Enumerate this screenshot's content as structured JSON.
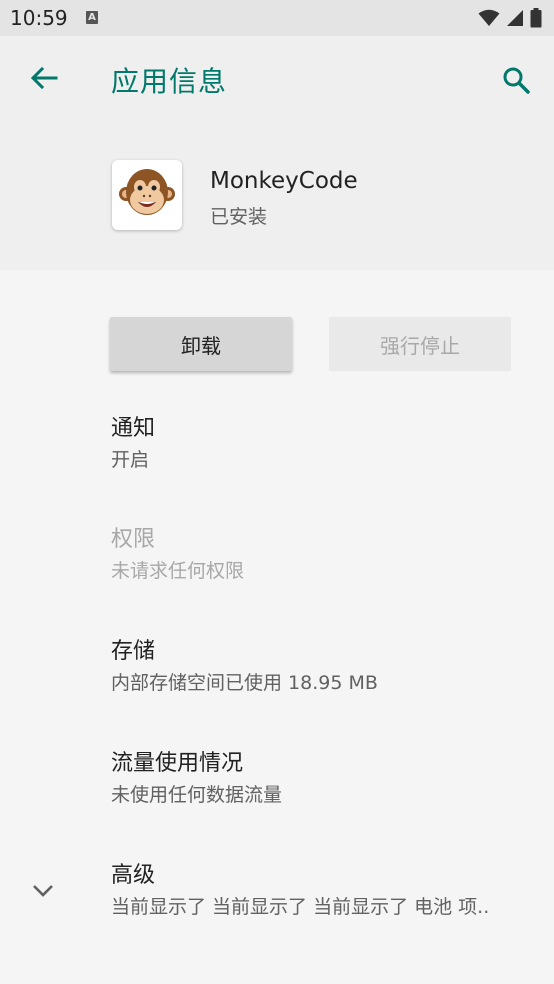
{
  "status_bar": {
    "time": "10:59",
    "notification_icon": "A",
    "icons": [
      "wifi-icon",
      "signal-icon",
      "battery-icon"
    ]
  },
  "header": {
    "title": "应用信息",
    "back_icon": "arrow-left-icon",
    "search_icon": "search-icon"
  },
  "app": {
    "name": "MonkeyCode",
    "status": "已安装",
    "icon": "monkey-face-icon"
  },
  "buttons": {
    "uninstall": "卸载",
    "force_stop": "强行停止"
  },
  "prefs": {
    "notifications": {
      "title": "通知",
      "summary": "开启"
    },
    "permissions": {
      "title": "权限",
      "summary": "未请求任何权限"
    },
    "storage": {
      "title": "存储",
      "summary": "内部存储空间已使用 18.95 MB"
    },
    "data_usage": {
      "title": "流量使用情况",
      "summary": "未使用任何数据流量"
    },
    "advanced": {
      "title": "高级",
      "summary": "当前显示了 当前显示了 当前显示了 电池 项.."
    }
  },
  "colors": {
    "accent": "#00796b",
    "status_bar_bg": "#e4e4e4",
    "header_bg": "#efefef",
    "page_bg": "#f5f5f5"
  }
}
